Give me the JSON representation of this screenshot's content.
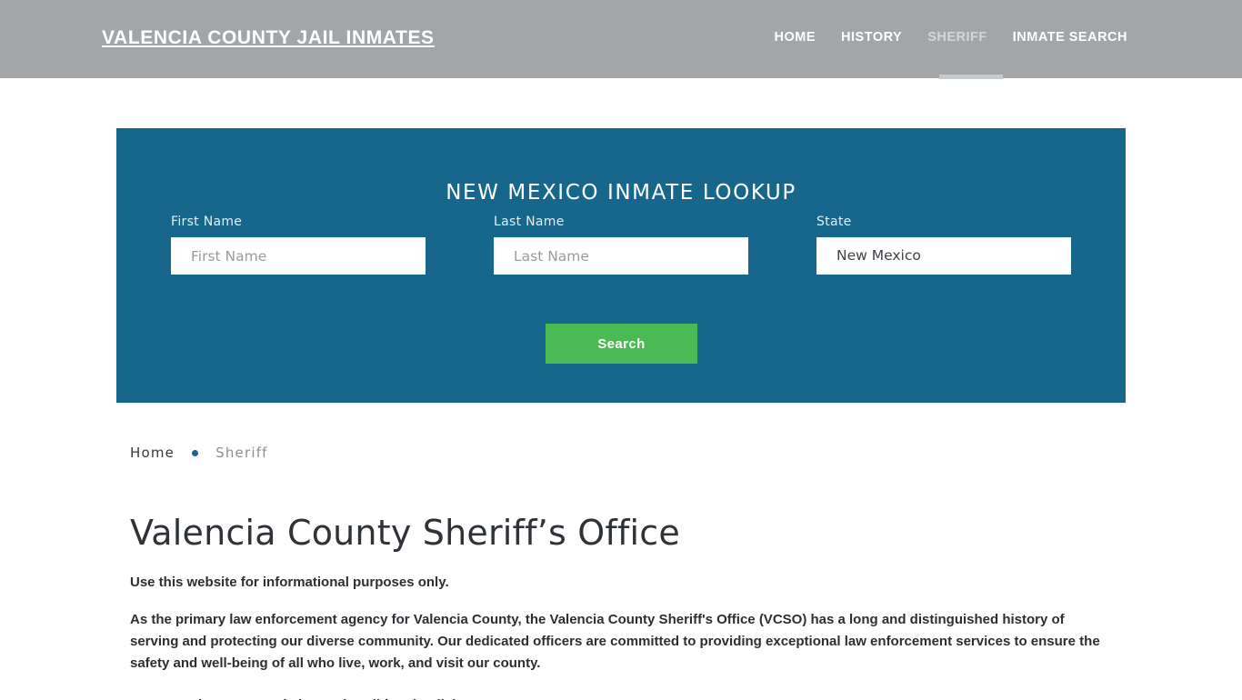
{
  "header": {
    "brand": "VALENCIA COUNTY JAIL INMATES",
    "nav": [
      {
        "label": "HOME",
        "active": false
      },
      {
        "label": "HISTORY",
        "active": false
      },
      {
        "label": "SHERIFF",
        "active": true
      },
      {
        "label": "INMATE SEARCH",
        "active": false
      }
    ]
  },
  "search_panel": {
    "title": "NEW MEXICO INMATE LOOKUP",
    "first_name": {
      "label": "First Name",
      "placeholder": "First Name",
      "value": ""
    },
    "last_name": {
      "label": "Last Name",
      "placeholder": "Last Name",
      "value": ""
    },
    "state": {
      "label": "State",
      "selected": "New Mexico"
    },
    "submit_label": "Search",
    "background_color": "#17678c",
    "button_color": "#4aba55"
  },
  "breadcrumb": {
    "home": "Home",
    "separator": "•",
    "current": "Sheriff"
  },
  "content": {
    "title": "Valencia County Sheriff’s Office",
    "lead": "Use this website for informational purposes only.",
    "paragraph": "As the primary law enforcement agency for Valencia County, the Valencia County Sheriff's Office (VCSO) has a long and distinguished history of serving and protecting our diverse community. Our dedicated officers are committed to providing exceptional law enforcement services to ensure the safety and well-being of all who live, work, and visit our county.",
    "paragraph_clipped": "Our commitment extends beyond traditional policing."
  }
}
